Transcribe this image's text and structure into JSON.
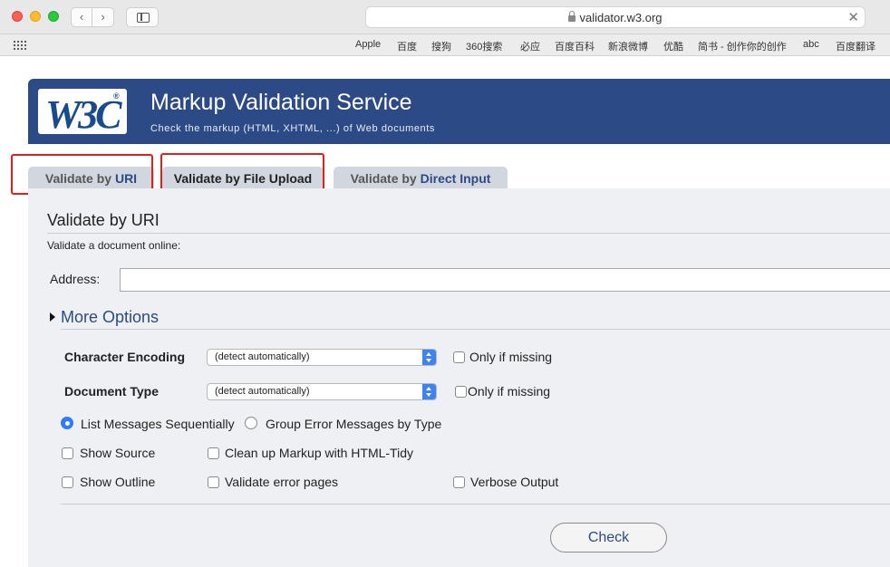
{
  "browser": {
    "url": "validator.w3.org",
    "bookmarks": [
      "Apple",
      "百度",
      "搜狗",
      "360搜索",
      "必应",
      "百度百科",
      "新浪微博",
      "优酷",
      "简书 - 创作你的创作",
      "abc",
      "百度翻译"
    ]
  },
  "header": {
    "logo_text": "W3C",
    "logo_mark": "®",
    "title": "Markup Validation Service",
    "subtitle": "Check the markup (HTML, XHTML, ...) of Web documents",
    "banner_color": "#2c4b86"
  },
  "tabs": [
    {
      "prefix": "Validate by ",
      "accent": "URI"
    },
    {
      "prefix": "Validate by File Upload",
      "accent": ""
    },
    {
      "prefix": "Validate by ",
      "accent": "Direct Input"
    }
  ],
  "section": {
    "title": "Validate by URI",
    "description": "Validate a document online:",
    "address_label": "Address:",
    "address_value": ""
  },
  "options": {
    "toggle_label": "More Options",
    "char_encoding_label": "Character Encoding",
    "char_encoding_value": "(detect automatically)",
    "doctype_label": "Document Type",
    "doctype_value": "(detect automatically)",
    "only_if_missing": "Only if missing",
    "list_sequential": "List Messages Sequentially",
    "group_by_type": "Group Error Messages by Type",
    "show_source": "Show Source",
    "cleanup_tidy": "Clean up Markup with HTML-Tidy",
    "show_outline": "Show Outline",
    "validate_error_pages": "Validate error pages",
    "verbose_output": "Verbose Output"
  },
  "check_label": "Check"
}
